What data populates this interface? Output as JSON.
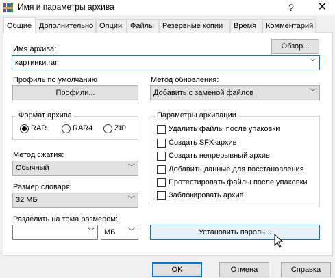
{
  "window": {
    "title": "Имя и параметры архива",
    "help_glyph": "?",
    "close_glyph": "✕",
    "icon": "winrar-books-icon"
  },
  "tabs": [
    {
      "label": "Общие",
      "active": true
    },
    {
      "label": "Дополнительно",
      "active": false
    },
    {
      "label": "Опции",
      "active": false
    },
    {
      "label": "Файлы",
      "active": false
    },
    {
      "label": "Резервные копии",
      "active": false
    },
    {
      "label": "Время",
      "active": false
    },
    {
      "label": "Комментарий",
      "active": false
    }
  ],
  "archive_name": {
    "label": "Имя архива:",
    "value": "картинки.rar",
    "browse_label": "Обзор..."
  },
  "profile": {
    "label": "Профиль по умолчанию",
    "button_label": "Профили..."
  },
  "update_method": {
    "label": "Метод обновления:",
    "value": "Добавить с заменой файлов"
  },
  "archive_format": {
    "title": "Формат архива",
    "options": [
      {
        "label": "RAR",
        "checked": true
      },
      {
        "label": "RAR4",
        "checked": false
      },
      {
        "label": "ZIP",
        "checked": false
      }
    ]
  },
  "archive_options": {
    "title": "Параметры архивации",
    "items": [
      {
        "label": "Удалить файлы после упаковки",
        "checked": false
      },
      {
        "label": "Создать SFX-архив",
        "checked": false
      },
      {
        "label": "Создать непрерывный архив",
        "checked": false
      },
      {
        "label": "Добавить данные для восстановления",
        "checked": false
      },
      {
        "label": "Протестировать файлы после упаковки",
        "checked": false
      },
      {
        "label": "Заблокировать архив",
        "checked": false
      }
    ]
  },
  "compression": {
    "label": "Метод сжатия:",
    "value": "Обычный"
  },
  "dictionary": {
    "label": "Размер словаря:",
    "value": "32 МБ"
  },
  "split": {
    "label": "Разделить на тома размером:",
    "size_value": "",
    "unit_value": "МБ"
  },
  "set_password": {
    "label": "Установить пароль..."
  },
  "footer": {
    "ok_label": "OK",
    "cancel_label": "Отмена",
    "help_label": "Справка"
  },
  "colors": {
    "accent": "#0078d7",
    "background": "#f0f0f0",
    "panel": "#ffffff"
  }
}
